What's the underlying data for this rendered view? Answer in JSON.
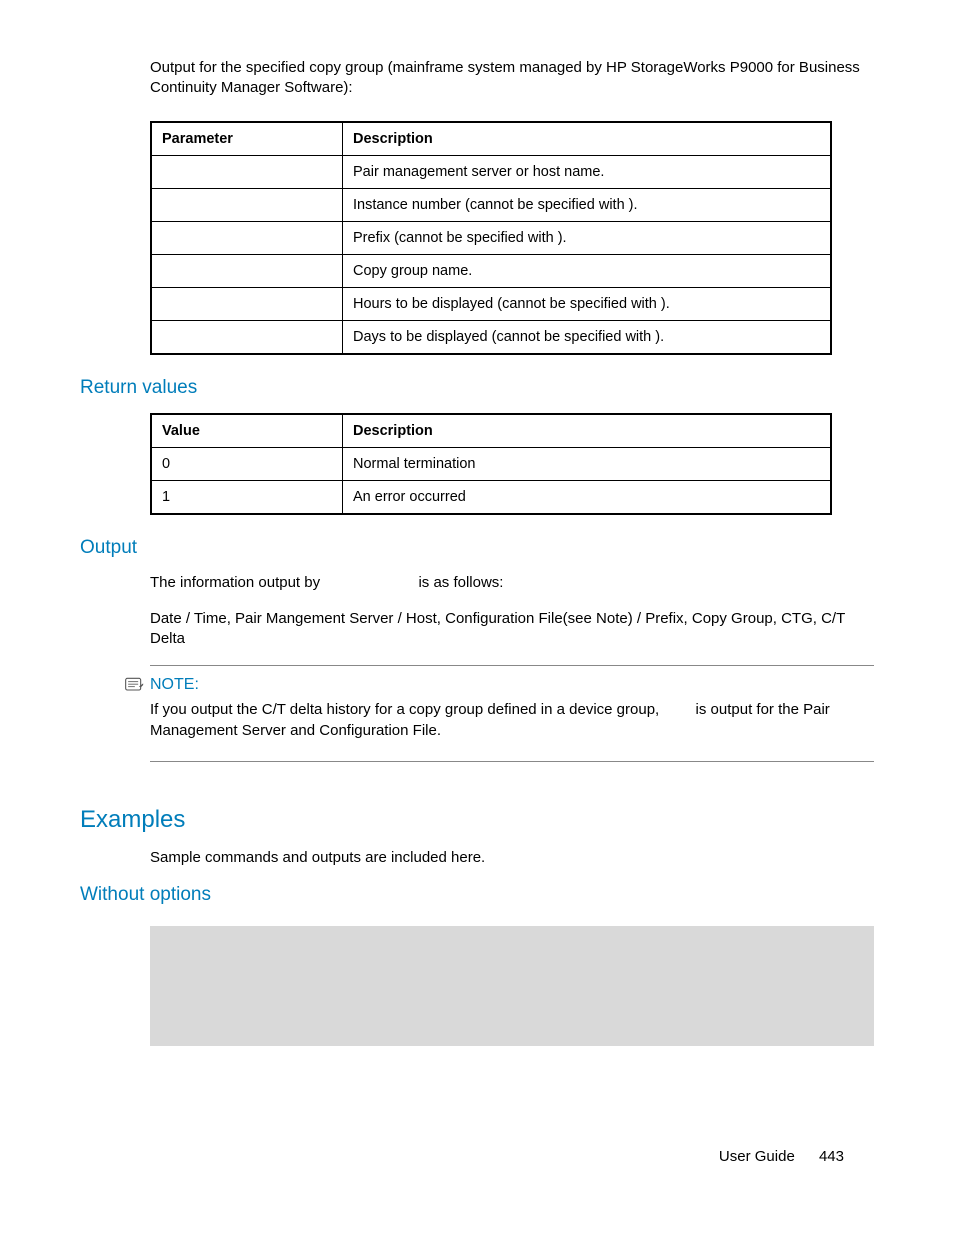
{
  "intro": "Output for the specified copy group (mainframe system managed by HP StorageWorks P9000 for Business Continuity Manager Software):",
  "table1": {
    "headers": {
      "param": "Parameter",
      "desc": "Description"
    },
    "rows": [
      {
        "param": "",
        "desc": "Pair management server or host name."
      },
      {
        "param": "",
        "desc": "Instance number (cannot be specified with                    )."
      },
      {
        "param": "",
        "desc": "Prefix (cannot be specified with                              )."
      },
      {
        "param": "",
        "desc": "Copy group name."
      },
      {
        "param": "",
        "desc": "Hours to be displayed (cannot be specified with            )."
      },
      {
        "param": "",
        "desc": "Days to be displayed (cannot be specified with              )."
      }
    ]
  },
  "return_heading": "Return values",
  "table2": {
    "headers": {
      "param": "Value",
      "desc": "Description"
    },
    "rows": [
      {
        "param": "0",
        "desc": "Normal termination"
      },
      {
        "param": "1",
        "desc": "An error occurred"
      }
    ]
  },
  "output_heading": "Output",
  "output_p1_a": "The information output by ",
  "output_p1_b": " is as follows:",
  "output_p2": "Date / Time, Pair Mangement Server / Host, Configuration File(see Note) / Prefix, Copy Group, CTG, C/T Delta",
  "note_label": "NOTE:",
  "note_body_a": "If you output the C/T delta history for a copy group defined in a device group, ",
  "note_body_b": " is output for the Pair Management Server and Configuration File.",
  "examples_heading": "Examples",
  "examples_intro": "Sample commands and outputs are included here.",
  "without_heading": "Without options",
  "footer_label": "User Guide",
  "footer_page": "443"
}
